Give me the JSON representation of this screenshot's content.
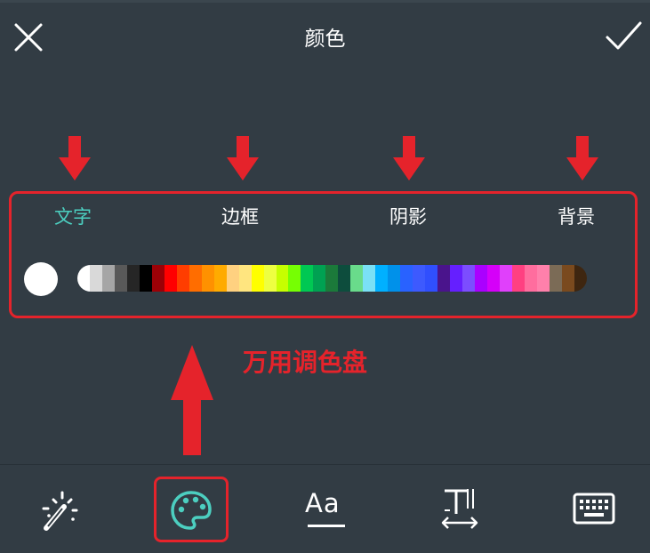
{
  "header": {
    "title": "颜色",
    "close_icon": "close-icon",
    "confirm_icon": "checkmark-icon"
  },
  "tabs": [
    {
      "label": "文字",
      "active": true
    },
    {
      "label": "边框",
      "active": false
    },
    {
      "label": "阴影",
      "active": false
    },
    {
      "label": "背景",
      "active": false
    }
  ],
  "annotation": {
    "label": "万用调色盘",
    "color": "#e5232b"
  },
  "colors": {
    "background": "#323c44",
    "accent": "#4ccfc0",
    "annotation_red": "#e5232b",
    "selected_color": "#ffffff"
  },
  "palette": [
    "#ffffff",
    "#d9d9d9",
    "#a6a6a6",
    "#595959",
    "#262626",
    "#000000",
    "#9c0006",
    "#ff0000",
    "#ff3d00",
    "#ff6d00",
    "#ff9100",
    "#ffab00",
    "#ffd180",
    "#ffe57f",
    "#ffff00",
    "#eeff41",
    "#c6ff00",
    "#76ff03",
    "#00c853",
    "#00a152",
    "#1b7a3a",
    "#0d4d3d",
    "#69db8b",
    "#7ae0f5",
    "#00b0ff",
    "#0091ea",
    "#2962ff",
    "#3d5afe",
    "#304ffe",
    "#4a148c",
    "#651fff",
    "#7c4dff",
    "#aa00ff",
    "#d500f9",
    "#e040fb",
    "#ff4081",
    "#ff6d9e",
    "#ff80ab",
    "#7b6b56",
    "#7a4a1e",
    "#3e2610"
  ],
  "toolbar": {
    "items": [
      {
        "name": "magic-wand",
        "icon": "magic-wand-icon"
      },
      {
        "name": "color-palette",
        "icon": "palette-icon"
      },
      {
        "name": "font",
        "label": "Aa",
        "icon": "font-icon"
      },
      {
        "name": "text-spacing",
        "label": "T",
        "icon": "text-spacing-icon"
      },
      {
        "name": "keyboard",
        "icon": "keyboard-icon"
      }
    ]
  }
}
